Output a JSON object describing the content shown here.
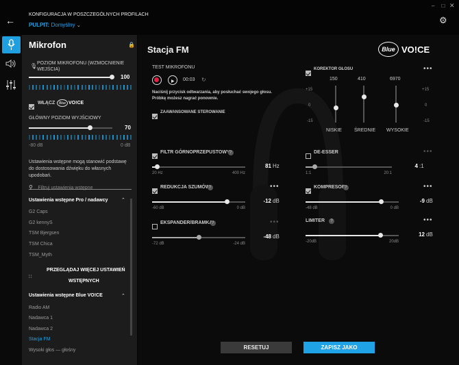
{
  "header": {
    "title": "KONFIGURACJA W POSZCZEGÓLNYCH PROFILACH",
    "desktop_label": "PULPIT:",
    "desktop_value": "Domyślny"
  },
  "sidebar": {
    "title": "Mikrofon",
    "mic_level_label": "POZIOM MIKROFONU (WZMOCNIENIE WEJŚCIA)",
    "mic_level_value": "100",
    "enable_label": "WŁĄCZ",
    "blue_voice": "VO!CE",
    "output_label": "GŁÓWNY POZIOM WYJŚCIOWY",
    "output_value": "70",
    "range_min": "-80 dB",
    "range_max": "0 dB",
    "presets_desc": "Ustawienia wstępne mogą stanowić podstawę do dostosowania dźwięku do własnych upodobań.",
    "filter_placeholder": "Filtruj ustawienia wstępne",
    "group1_title": "Ustawienia wstępne Pro / nadawcy",
    "group1_items": [
      "G2 Caps",
      "G2 kennyS",
      "TSM Bjergsen",
      "TSM Chica",
      "TSM_Myth"
    ],
    "browse_more_line1": "PRZEGLĄDAJ WIĘCEJ USTAWIEŃ",
    "browse_more_line2": "WSTĘPNYCH",
    "group2_title": "Ustawienia wstępne Blue VO!CE",
    "group2_items": [
      "Radio AM",
      "Nadawca 1",
      "Nadawca 2",
      "Stacja FM",
      "Wysoki głos — głośny"
    ]
  },
  "main": {
    "preset_title": "Stacja FM",
    "logo_blue": "Blue",
    "logo_voice": "VO!CE",
    "test_label": "TEST MIKROFONU",
    "test_time": "00:03",
    "test_desc_line1": "Naciśnij przycisk odtwarzania, aby posłuchać swojego głosu.",
    "test_desc_line2": "Próbkę możesz nagrać ponownie.",
    "advanced_label": "ZAAWANSOWANE STEROWANIE",
    "eq": {
      "label": "KOREKTOR GŁOSU",
      "bands": [
        {
          "freq": "150",
          "name": "NISKIE",
          "level": 0.6
        },
        {
          "freq": "410",
          "name": "ŚREDNIE",
          "level": 0.3
        },
        {
          "freq": "6970",
          "name": "WYSOKIE",
          "level": 0.52
        }
      ],
      "scale_top": "+15",
      "scale_mid": "0",
      "scale_bottom": "-15"
    },
    "highpass": {
      "label": "FILTR GÓRNOPRZEPUSTOWY",
      "value": "81",
      "unit": "Hz",
      "min": "20 Hz",
      "max": "400 Hz",
      "level": 0.05
    },
    "deesser": {
      "label": "DE-ESSER",
      "value": "4",
      "unit": ":1",
      "min": "1:1",
      "max": "20:1",
      "level": 0.1
    },
    "noise": {
      "label": "REDUKCJA SZUMÓW",
      "value": "-12",
      "unit": "dB",
      "min": "-60 dB",
      "max": "0 dB",
      "level": 0.8
    },
    "compressor": {
      "label": "KOMPRESOR",
      "value": "-9",
      "unit": "dB",
      "min": "-48 dB",
      "max": "0 dB",
      "level": 0.81
    },
    "expander": {
      "label": "EKSPANDER/BRAMKA",
      "value": "-48",
      "unit": "dB",
      "min": "-72 dB",
      "max": "-24 dB",
      "level": 0.5
    },
    "limiter": {
      "label": "LIMITER",
      "value": "12",
      "unit": "dB",
      "min": "-20dB",
      "max": "20dB",
      "level": 0.8
    },
    "reset_label": "RESETUJ",
    "save_label": "ZAPISZ JAKO"
  },
  "colors": {
    "accent": "#1fa3e6",
    "record": "#e02040"
  }
}
